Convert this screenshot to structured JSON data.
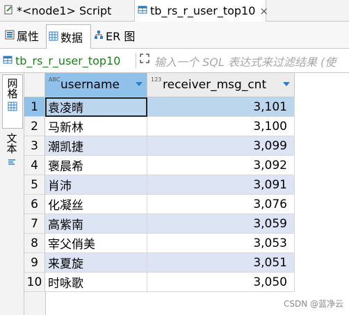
{
  "tabs": [
    {
      "label": "*<node1> Script",
      "icon": "sql-script-icon"
    },
    {
      "label": "tb_rs_r_user_top10",
      "icon": "table-icon",
      "close": "×"
    }
  ],
  "subtabs": [
    {
      "label": "属性",
      "icon": "properties-icon"
    },
    {
      "label": "数据",
      "icon": "grid-icon"
    },
    {
      "label": "ER 图",
      "icon": "er-diagram-icon"
    }
  ],
  "filter": {
    "table_name": "tb_rs_r_user_top10",
    "placeholder": "输入一个 SQL 表达式来过滤结果 (使"
  },
  "side": {
    "grid_label": "网格",
    "text_label": "文本"
  },
  "grid": {
    "type_badges": [
      "ABC",
      "123"
    ],
    "columns": [
      "username",
      "receiver_msg_cnt"
    ],
    "rows": [
      {
        "n": "1",
        "username": "袁凌晴",
        "cnt": "3,101"
      },
      {
        "n": "2",
        "username": "马新林",
        "cnt": "3,100"
      },
      {
        "n": "3",
        "username": "潮凯捷",
        "cnt": "3,099"
      },
      {
        "n": "4",
        "username": "褒晨希",
        "cnt": "3,092"
      },
      {
        "n": "5",
        "username": "肖沛",
        "cnt": "3,091"
      },
      {
        "n": "6",
        "username": "化凝丝",
        "cnt": "3,076"
      },
      {
        "n": "7",
        "username": "高紫南",
        "cnt": "3,059"
      },
      {
        "n": "8",
        "username": "宰父俏美",
        "cnt": "3,053"
      },
      {
        "n": "9",
        "username": "来夏旋",
        "cnt": "3,051"
      },
      {
        "n": "10",
        "username": "时咏歌",
        "cnt": "3,050"
      }
    ]
  },
  "watermark": "CSDN @蓝净云",
  "colors": {
    "accent": "#8fc1ea",
    "filter_text": "#1a7f1a",
    "alt_row": "#dde5f4"
  }
}
